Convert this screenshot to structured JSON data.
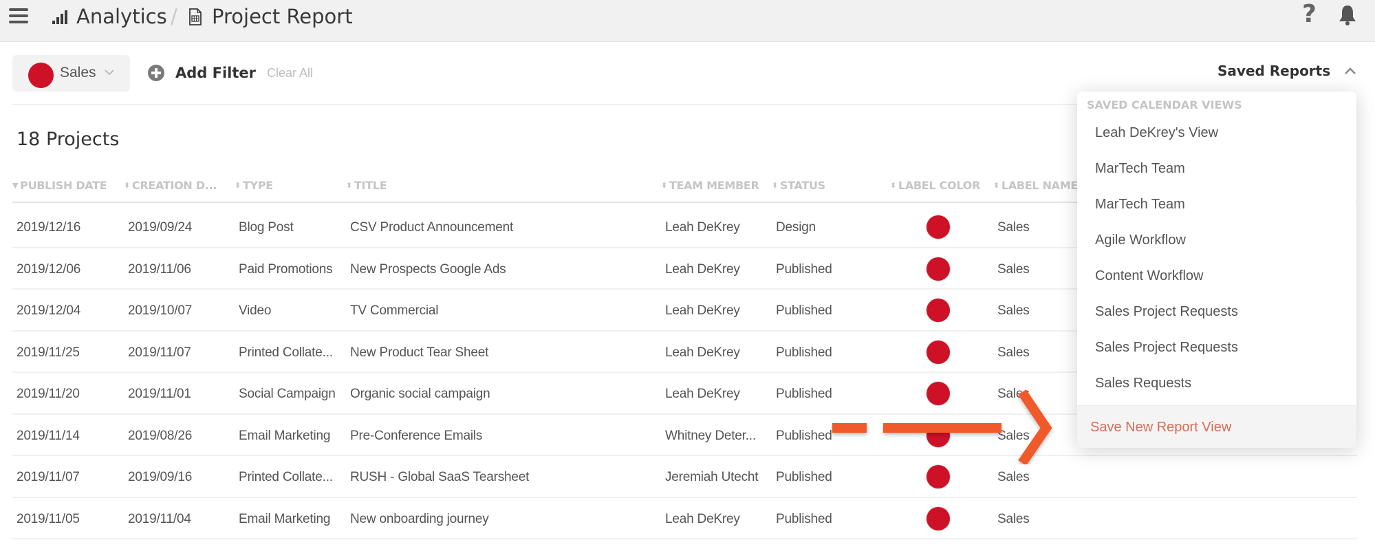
{
  "header": {
    "menu_icon": "hamburger-icon",
    "section_icon": "bar-chart-icon",
    "section": "Analytics",
    "separator": "/",
    "page_icon": "spreadsheet-doc-icon",
    "page_title": "Project Report",
    "help_icon_glyph": "?",
    "help_icon": "help-icon",
    "notification_icon": "bell-icon"
  },
  "filters": {
    "active_filter": {
      "label": "Sales",
      "color": "#ce1126"
    },
    "add_filter_label": "Add Filter",
    "clear_all_label": "Clear All",
    "saved_reports_label": "Saved Reports"
  },
  "summary": {
    "count_label": "18 Projects"
  },
  "table": {
    "columns": [
      {
        "label": "PUBLISH DATE",
        "sort": "desc"
      },
      {
        "label": "CREATION D...",
        "sort": "both"
      },
      {
        "label": "TYPE",
        "sort": "both"
      },
      {
        "label": "TITLE",
        "sort": "both"
      },
      {
        "label": "TEAM MEMBER",
        "sort": "both"
      },
      {
        "label": "STATUS",
        "sort": "both"
      },
      {
        "label": "LABEL COLOR",
        "sort": "both"
      },
      {
        "label": "LABEL NAME",
        "sort": "both"
      }
    ],
    "sort_glyphs": {
      "desc": "▼",
      "both": "⬍"
    },
    "rows": [
      {
        "publish_date": "2019/12/16",
        "creation_date": "2019/09/24",
        "type": "Blog Post",
        "title": "CSV Product Announcement",
        "team_member": "Leah DeKrey",
        "status": "Design",
        "label_color": "#ce1126",
        "label_name": "Sales"
      },
      {
        "publish_date": "2019/12/06",
        "creation_date": "2019/11/06",
        "type": "Paid Promotions",
        "title": "New Prospects Google Ads",
        "team_member": "Leah DeKrey",
        "status": "Published",
        "label_color": "#ce1126",
        "label_name": "Sales"
      },
      {
        "publish_date": "2019/12/04",
        "creation_date": "2019/10/07",
        "type": "Video",
        "title": "TV Commercial",
        "team_member": "Leah DeKrey",
        "status": "Published",
        "label_color": "#ce1126",
        "label_name": "Sales"
      },
      {
        "publish_date": "2019/11/25",
        "creation_date": "2019/11/07",
        "type": "Printed Collate...",
        "title": "New Product Tear Sheet",
        "team_member": "Leah DeKrey",
        "status": "Published",
        "label_color": "#ce1126",
        "label_name": "Sales"
      },
      {
        "publish_date": "2019/11/20",
        "creation_date": "2019/11/01",
        "type": "Social Campaign",
        "title": "Organic social campaign",
        "team_member": "Leah DeKrey",
        "status": "Published",
        "label_color": "#ce1126",
        "label_name": "Sales"
      },
      {
        "publish_date": "2019/11/14",
        "creation_date": "2019/08/26",
        "type": "Email Marketing",
        "title": "Pre-Conference Emails",
        "team_member": "Whitney Deter...",
        "status": "Published",
        "label_color": "#ce1126",
        "label_name": "Sales"
      },
      {
        "publish_date": "2019/11/07",
        "creation_date": "2019/09/16",
        "type": "Printed Collate...",
        "title": "RUSH - Global SaaS Tearsheet",
        "team_member": "Jeremiah Utecht",
        "status": "Published",
        "label_color": "#ce1126",
        "label_name": "Sales"
      },
      {
        "publish_date": "2019/11/05",
        "creation_date": "2019/11/04",
        "type": "Email Marketing",
        "title": "New onboarding journey",
        "team_member": "Leah DeKrey",
        "status": "Published",
        "label_color": "#ce1126",
        "label_name": "Sales"
      }
    ]
  },
  "saved_reports_menu": {
    "section_header": "SAVED CALENDAR VIEWS",
    "items": [
      "Leah DeKrey's View",
      "MarTech Team",
      "MarTech Team",
      "Agile Workflow",
      "Content Workflow",
      "Sales Project Requests",
      "Sales Project Requests",
      "Sales Requests"
    ],
    "save_new_label": "Save New Report View"
  },
  "annotation": {
    "arrow_color": "#f05a2a",
    "arrow_points_to": "Save New Report View"
  },
  "colors": {
    "accent": "#d96b56",
    "label_red": "#ce1126",
    "header_bg": "#f1f1f1"
  }
}
